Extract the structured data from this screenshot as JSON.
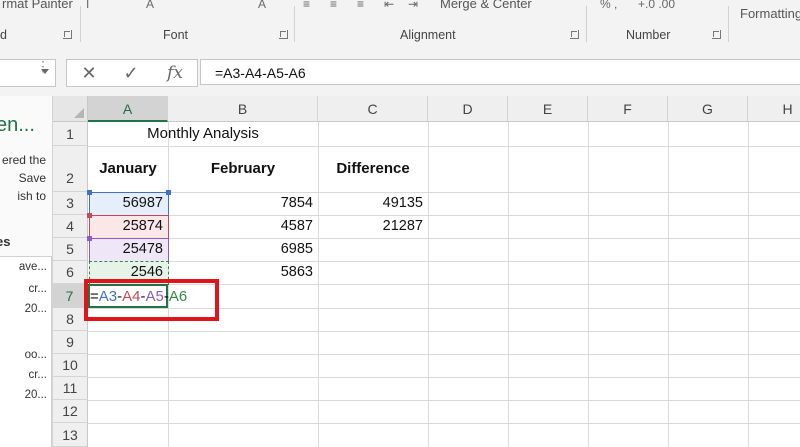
{
  "ribbon": {
    "format_painter_label": "rmat Painter",
    "clipboard_label": "d",
    "font_label": "Font",
    "alignment_label": "Alignment",
    "number_label": "Number",
    "merge_center_label": "Merge & Center",
    "formatting_label": "Formatting",
    "number_format_glyphs": "% ,",
    "decimal_glyphs": "+.0 .00"
  },
  "formula_bar": {
    "cancel_glyph": "✕",
    "enter_glyph": "✓",
    "fx_glyph": "fx",
    "value": "=A3-A4-A5-A6"
  },
  "task_pane": {
    "title": "en...",
    "description": "ered the\n Save\nish to\n",
    "section_heading": "es",
    "recent_items": [
      "ave...",
      "cr...",
      "20...",
      "oo...",
      "cr...",
      "20..."
    ]
  },
  "grid": {
    "columns": [
      "A",
      "B",
      "C",
      "D",
      "E",
      "F",
      "G",
      "H"
    ],
    "rows": [
      "1",
      "2",
      "3",
      "4",
      "5",
      "6",
      "7",
      "8",
      "9",
      "10",
      "11",
      "12",
      "13"
    ],
    "selected_column": "A",
    "selected_row": "7",
    "title_cell": "Monthly Analysis",
    "headers": {
      "a": "January",
      "b": "February",
      "c": "Difference"
    },
    "data": [
      {
        "row": "3",
        "a": "56987",
        "b": "7854",
        "c": "49135"
      },
      {
        "row": "4",
        "a": "25874",
        "b": "4587",
        "c": "21287"
      },
      {
        "row": "5",
        "a": "25478",
        "b": "6985",
        "c": ""
      },
      {
        "row": "6",
        "a": "2546",
        "b": "5863",
        "c": ""
      }
    ],
    "edit_formula": {
      "eq": "=",
      "ref1": "A3",
      "op1": "-",
      "ref2": "A4",
      "op2": "-",
      "ref3": "A5",
      "op3": "-",
      "ref4": "A6"
    }
  },
  "colors": {
    "accent_green": "#217346",
    "ref_a3": "#3f72c6",
    "ref_a4": "#c04a55",
    "ref_a5": "#8a5cc4",
    "ref_a6": "#2f8a4a",
    "highlight_box": "#e0151c"
  }
}
